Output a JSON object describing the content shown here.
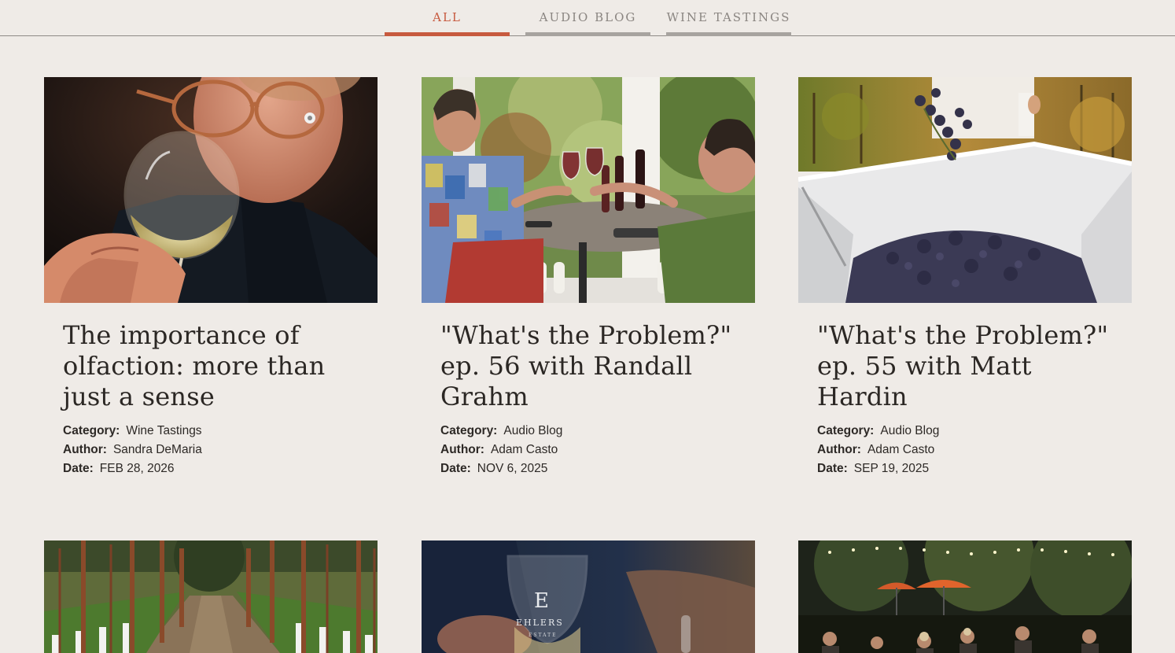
{
  "tabs": [
    {
      "label": "ALL",
      "active": true
    },
    {
      "label": "AUDIO BLOG",
      "active": false
    },
    {
      "label": "WINE TASTINGS",
      "active": false
    }
  ],
  "colors": {
    "background": "#efebe7",
    "accent": "#c75a3f",
    "tab_inactive": "#a7a39f",
    "text": "#2b2724"
  },
  "meta_labels": {
    "category": "Category:",
    "author": "Author:",
    "date": "Date:"
  },
  "posts": [
    {
      "title": "The importance of olfaction: more than just a sense",
      "category": "Wine Tastings",
      "author": "Sandra DeMaria",
      "date": "FEB 28, 2026",
      "image": "man-smelling-white-wine-glass"
    },
    {
      "title": "\"What's the Problem?\" ep. 56 with Randall Grahm",
      "category": "Audio Blog",
      "author": "Adam Casto",
      "date": "NOV 6, 2025",
      "image": "couple-toasting-red-wine-on-terrace"
    },
    {
      "title": "\"What's the Problem?\" ep. 55 with Matt Hardin",
      "category": "Audio Blog",
      "author": "Adam Casto",
      "date": "SEP 19, 2025",
      "image": "grapes-poured-into-harvest-bin"
    },
    {
      "image": "vineyard-rows"
    },
    {
      "image": "engraved-wine-glass",
      "glass_text_1": "E",
      "glass_text_2": "EHLERS",
      "glass_text_3": "ESTATE"
    },
    {
      "image": "outdoor-evening-dinner"
    }
  ]
}
